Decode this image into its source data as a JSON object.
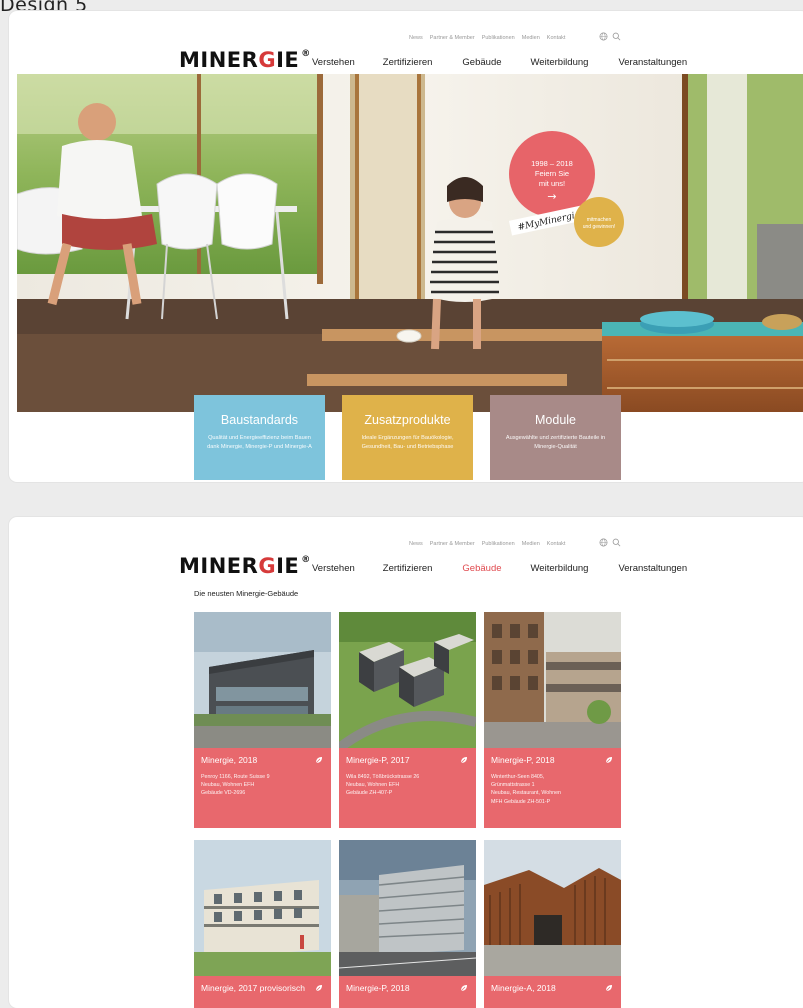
{
  "window": {
    "label": "Design 5"
  },
  "header": {
    "utility_links": [
      "News",
      "Partner & Member",
      "Publikationen",
      "Medien",
      "Kontakt"
    ],
    "logo": {
      "part1": "MINER",
      "part2": "G",
      "part3": "IE",
      "reg": "®"
    },
    "nav": [
      "Verstehen",
      "Zertifizieren",
      "Gebäude",
      "Weiterbildung",
      "Veranstaltungen"
    ]
  },
  "hero": {
    "badge": {
      "line1": "1998 – 2018",
      "line2": "Feiern Sie",
      "line3": "mit uns!",
      "arrow": "→"
    },
    "hashtag": "#MyMinergie",
    "yellow_badge": {
      "line1": "mitmachen",
      "line2": "und gewinnen!"
    }
  },
  "features": [
    {
      "title": "Baustandards",
      "desc": "Qualität und Energieeffizienz beim Bauen dank Minergie, Minergie-P und Minergie-A",
      "color": "#7ec4dc"
    },
    {
      "title": "Zusatzprodukte",
      "desc": "Ideale Ergänzungen für Bauökologie, Gesundheit, Bau- und Betriebsphase",
      "color": "#dfb24a"
    },
    {
      "title": "Module",
      "desc": "Ausgewählte und zertifizierte Bauteile in Minergie-Qualität",
      "color": "#a88a88"
    }
  ],
  "gallery": {
    "heading": "Die neusten Minergie-Gebäude",
    "active_nav": "Gebäude",
    "tiles": [
      {
        "title": "Minergie, 2018",
        "desc": "Penroy 1166, Route Suisse 9\nNeubau, Wohnen EFH\nGebäude VD-2696",
        "icon": "leaf-icon"
      },
      {
        "title": "Minergie-P, 2017",
        "desc": "Wila 8492, Tößbrückstrasse 26\nNeubau, Wohnen EFH\nGebäude ZH-407-P",
        "icon": "leaf-icon"
      },
      {
        "title": "Minergie-P, 2018",
        "desc": "Winterthur-Seen 8405,\nGrünmattstrasse 1\nNeubau, Restaurant, Wohnen\nMFH Gebäude ZH-501-P",
        "icon": "leaf-icon"
      },
      {
        "title": "Minergie, 2017 provisorisch",
        "desc": "",
        "icon": "leaf-icon"
      },
      {
        "title": "Minergie-P, 2018",
        "desc": "",
        "icon": "leaf-icon"
      },
      {
        "title": "Minergie-A, 2018",
        "desc": "",
        "icon": "leaf-icon"
      }
    ]
  },
  "colors": {
    "accent_red": "#e8686d",
    "logo_red": "#d63a3a",
    "blue": "#7ec4dc",
    "gold": "#dfb24a",
    "mauve": "#a88a88"
  }
}
